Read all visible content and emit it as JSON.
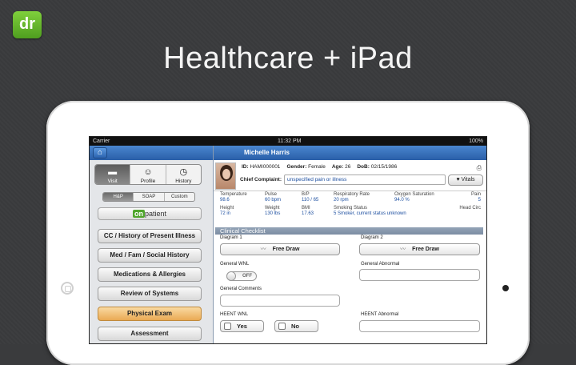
{
  "brand": {
    "logo_text": "dr",
    "logo_color": "#5fb22a"
  },
  "headline": "Healthcare + iPad",
  "status_bar": {
    "carrier": "Carrier",
    "time": "11:32 PM",
    "battery": "100%"
  },
  "left_panel": {
    "home_icon": "home-icon",
    "visit_tabs": [
      {
        "label": "Visit",
        "icon": "folder-icon",
        "active": true
      },
      {
        "label": "Profile",
        "icon": "person-icon",
        "active": false
      },
      {
        "label": "History",
        "icon": "clock-icon",
        "active": false
      }
    ],
    "note_tabs": [
      {
        "label": "H&P",
        "active": true
      },
      {
        "label": "SOAP",
        "active": false
      },
      {
        "label": "Custom",
        "active": false
      }
    ],
    "onpatient": {
      "prefix": "on",
      "suffix": "patient"
    },
    "menu": [
      {
        "label": "CC / History of Present Illness"
      },
      {
        "label": "Med / Fam / Social History"
      },
      {
        "label": "Medications & Allergies"
      },
      {
        "label": "Review of Systems"
      },
      {
        "label": "Physical Exam",
        "selected": true
      },
      {
        "label": "Assessment"
      }
    ]
  },
  "patient": {
    "name": "Michelle Harris",
    "id_label": "ID:",
    "id": "HAMI000001",
    "gender_label": "Gender:",
    "gender": "Female",
    "age_label": "Age:",
    "age": "26",
    "dob_label": "DoB:",
    "dob": "02/15/1986",
    "chief_complaint_label": "Chief Complaint:",
    "chief_complaint": "unspecified pain or illness",
    "vitals_button": "Vitals"
  },
  "vitals": {
    "row1": [
      {
        "label": "Temperature",
        "value": "98.6"
      },
      {
        "label": "Pulse",
        "value": "60 bpm"
      },
      {
        "label": "B/P",
        "value": "110 / 65"
      },
      {
        "label": "Respiratory Rate",
        "value": "20 rpm"
      },
      {
        "label": "Oxygen Saturation",
        "value": "94.0 %"
      },
      {
        "label": "Pain",
        "value": "5"
      }
    ],
    "row2": [
      {
        "label": "Height",
        "value": "72 in"
      },
      {
        "label": "Weight",
        "value": "130 lbs"
      },
      {
        "label": "BMI",
        "value": "17.63"
      },
      {
        "label": "Smoking Status",
        "value": "5 Smoker, current status unknown"
      },
      {
        "label": "",
        "value": ""
      },
      {
        "label": "Head Circ",
        "value": ""
      }
    ]
  },
  "checklist": {
    "title": "Clinical Checklist",
    "diagram1_label": "Diagram 1",
    "diagram2_label": "Diagram 2",
    "free_draw": "Free Draw",
    "general_wnl_label": "General WNL",
    "toggle_off": "OFF",
    "general_abnormal_label": "General Abnormal",
    "general_comments_label": "General Comments",
    "heent_wnl_label": "HEENT WNL",
    "yes": "Yes",
    "no": "No",
    "heent_abnormal_label": "HEENT Abnormal"
  }
}
